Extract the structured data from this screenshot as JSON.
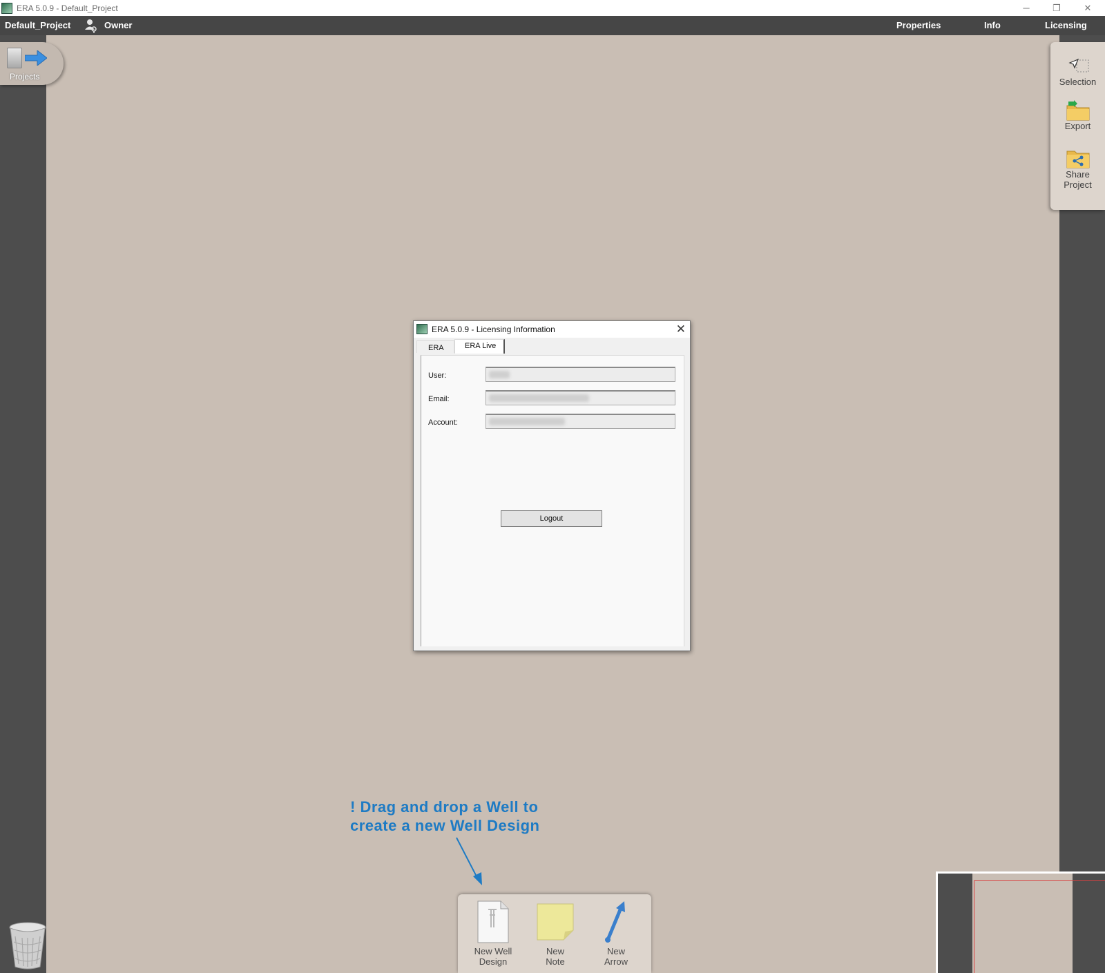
{
  "window": {
    "title": "ERA 5.0.9 - Default_Project",
    "controls": {
      "minimize": "─",
      "restore": "❐",
      "close": "✕"
    }
  },
  "menubar": {
    "project_name": "Default_Project",
    "owner": "Owner",
    "items": [
      {
        "label": "Properties"
      },
      {
        "label": "Info"
      },
      {
        "label": "Licensing"
      }
    ]
  },
  "left_panel": {
    "projects_label": "Projects"
  },
  "tool_panel": {
    "selection": "Selection",
    "export": "Export",
    "share": "Share Project"
  },
  "dialog": {
    "title": "ERA 5.0.9 - Licensing Information",
    "close": "✕",
    "tabs": [
      {
        "label": "ERA",
        "active": false
      },
      {
        "label": "ERA Live",
        "active": true
      }
    ],
    "fields": {
      "user_label": "User:",
      "email_label": "Email:",
      "account_label": "Account:"
    },
    "logout_label": "Logout"
  },
  "hint": {
    "line1": "! Drag and drop a Well to",
    "line2": "create a new Well Design"
  },
  "palette": {
    "new_well_design": "New Well Design",
    "new_note": "New Note",
    "new_arrow": "New Arrow"
  },
  "colors": {
    "canvas": "#c9beb4",
    "dark_margin": "#4d4d4d",
    "menubar": "#464646",
    "hint_blue": "#1e7bc4",
    "note_yellow": "#ede89a"
  }
}
